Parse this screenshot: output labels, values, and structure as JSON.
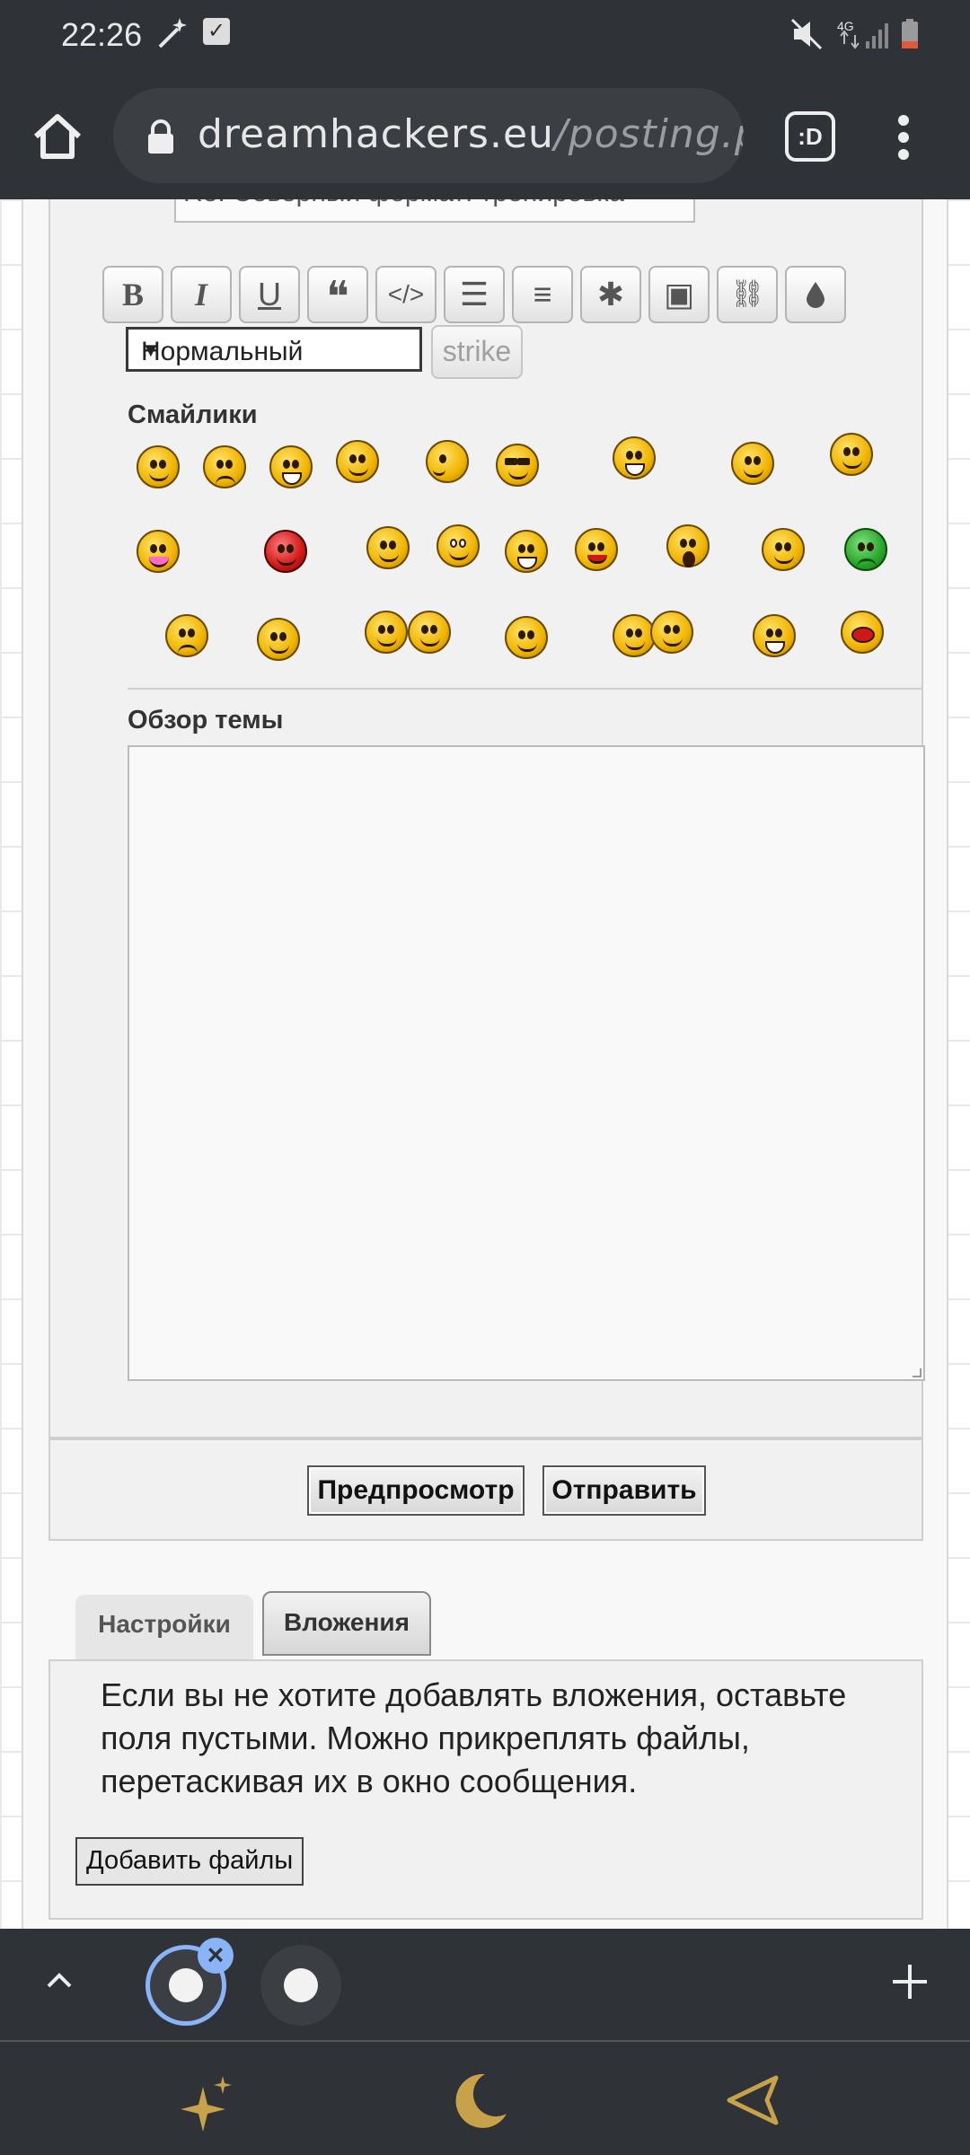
{
  "status_bar": {
    "time": "22:26",
    "network": "4G",
    "icons": [
      "magic-wand-icon",
      "checkbox-icon",
      "mute-icon",
      "signal-icon",
      "battery-low-icon"
    ]
  },
  "browser": {
    "url_domain": "dreamhackers.eu",
    "url_path": "/posting.php?",
    "extension_label": ":D"
  },
  "form": {
    "subject_value": "Re: Северный формат: тренировка",
    "toolbar_buttons": [
      {
        "name": "bold",
        "glyph": "B"
      },
      {
        "name": "italic",
        "glyph": "I"
      },
      {
        "name": "underline",
        "glyph": "U"
      },
      {
        "name": "quote",
        "glyph": "❝"
      },
      {
        "name": "code",
        "glyph": "</>"
      },
      {
        "name": "list",
        "glyph": "☰"
      },
      {
        "name": "ordered-list",
        "glyph": "≡"
      },
      {
        "name": "list-item",
        "glyph": "✱"
      },
      {
        "name": "image",
        "glyph": "▣"
      },
      {
        "name": "link",
        "glyph": "⛓"
      },
      {
        "name": "color",
        "glyph": "💧"
      }
    ],
    "font_size_selected": "Нормальный",
    "strike_label": "strike",
    "smilies_title": "Смайлики",
    "smiley_count": 27,
    "topic_review_title": "Обзор темы"
  },
  "actions": {
    "preview_label": "Предпросмотр",
    "submit_label": "Отправить"
  },
  "tabs": {
    "settings_label": "Настройки",
    "attachments_label": "Вложения"
  },
  "attachments": {
    "info_text": "Если вы не хотите добавлять вложения, оставьте поля пустыми. Можно прикреплять файлы, перетаскивая их в окно сообщения.",
    "add_files_label": "Добавить файлы"
  },
  "colors": {
    "chrome_dark": "#2f3236",
    "accent_blue": "#8ab4f8",
    "panel_bg": "#f1f1f1",
    "smiley_yellow": "#f0b400"
  }
}
